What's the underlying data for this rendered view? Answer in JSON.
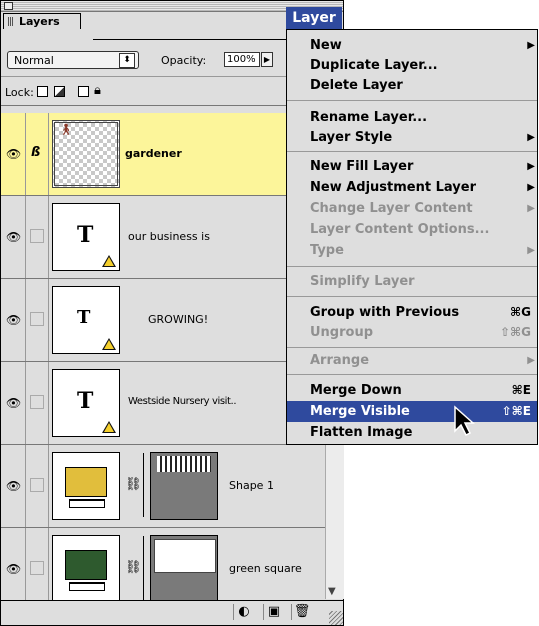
{
  "palette": {
    "tab_label": "Layers",
    "blend_mode": "Normal",
    "opacity_label": "Opacity:",
    "opacity_value": "100%",
    "lock_label": "Lock:",
    "layers": [
      {
        "name": "gardener",
        "selected": true,
        "kind": "image"
      },
      {
        "name": "our business is",
        "selected": false,
        "kind": "text",
        "glyph": "T"
      },
      {
        "name": "GROWING!",
        "selected": false,
        "kind": "text",
        "glyph": "T"
      },
      {
        "name": "Westside Nursery visit..",
        "selected": false,
        "kind": "text",
        "glyph": "T"
      },
      {
        "name": "Shape 1",
        "selected": false,
        "kind": "shape",
        "color": "#e1be3c"
      },
      {
        "name": "green square",
        "selected": false,
        "kind": "shape",
        "color": "#2e5a2e"
      }
    ]
  },
  "menu": {
    "title": "Layer",
    "accent": "#2f4a9e",
    "items": [
      {
        "label": "New",
        "shortcut": "",
        "submenu": true,
        "disabled": false
      },
      {
        "label": "Duplicate Layer...",
        "shortcut": "",
        "submenu": false,
        "disabled": false
      },
      {
        "label": "Delete Layer",
        "shortcut": "",
        "submenu": false,
        "disabled": false
      },
      {
        "label": "Rename Layer...",
        "shortcut": "",
        "submenu": false,
        "disabled": false
      },
      {
        "label": "Layer Style",
        "shortcut": "",
        "submenu": true,
        "disabled": false
      },
      {
        "label": "New Fill Layer",
        "shortcut": "",
        "submenu": true,
        "disabled": false
      },
      {
        "label": "New Adjustment Layer",
        "shortcut": "",
        "submenu": true,
        "disabled": false
      },
      {
        "label": "Change Layer Content",
        "shortcut": "",
        "submenu": true,
        "disabled": true
      },
      {
        "label": "Layer Content Options...",
        "shortcut": "",
        "submenu": false,
        "disabled": true
      },
      {
        "label": "Type",
        "shortcut": "",
        "submenu": true,
        "disabled": true
      },
      {
        "label": "Simplify Layer",
        "shortcut": "",
        "submenu": false,
        "disabled": true
      },
      {
        "label": "Group with Previous",
        "shortcut": "⌘G",
        "submenu": false,
        "disabled": false
      },
      {
        "label": "Ungroup",
        "shortcut": "⇧⌘G",
        "submenu": false,
        "disabled": true
      },
      {
        "label": "Arrange",
        "shortcut": "",
        "submenu": true,
        "disabled": true
      },
      {
        "label": "Merge Down",
        "shortcut": "⌘E",
        "submenu": false,
        "disabled": false
      },
      {
        "label": "Merge Visible",
        "shortcut": "⇧⌘E",
        "submenu": false,
        "disabled": false,
        "highlighted": true
      },
      {
        "label": "Flatten Image",
        "shortcut": "",
        "submenu": false,
        "disabled": false
      }
    ]
  }
}
